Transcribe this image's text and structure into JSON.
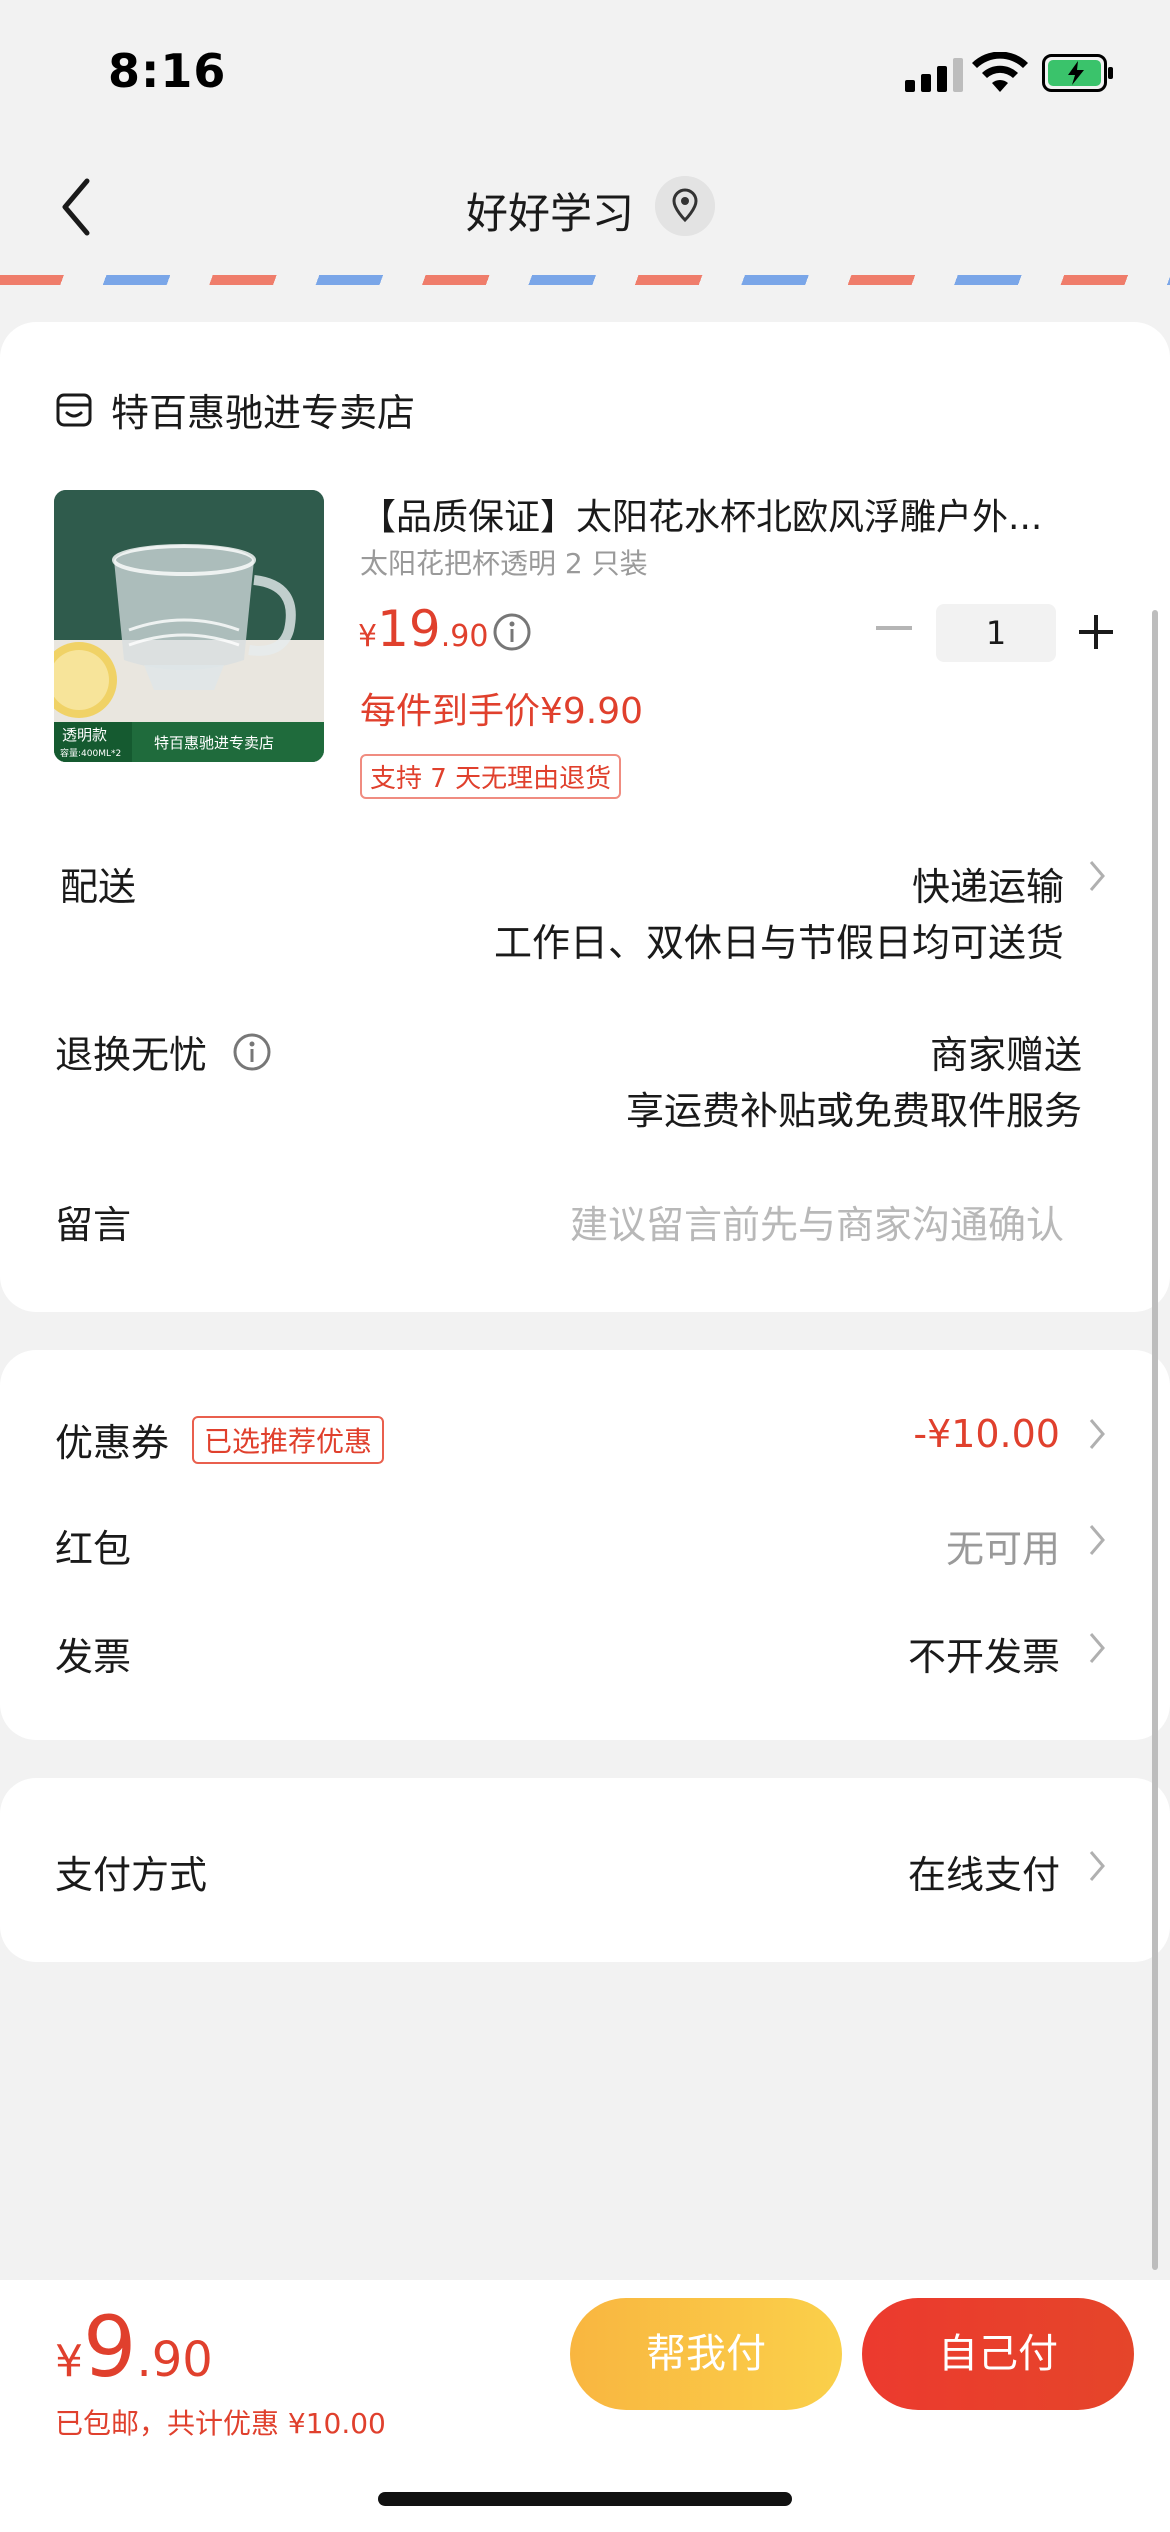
{
  "status_bar": {
    "time": "8:16"
  },
  "nav": {
    "title": "好好学习"
  },
  "shop": {
    "name": "特百惠驰进专卖店"
  },
  "product": {
    "title": "【品质保证】太阳花水杯北欧风浮雕户外...",
    "spec": "太阳花把杯透明 2 只装",
    "price_symbol": "¥",
    "price_int": "19",
    "price_dec": ".90",
    "final_price": "每件到手价¥9.90",
    "return_badge": "支持 7 天无理由退货",
    "quantity": "1",
    "image_texts": {
      "tag": "透明款",
      "capacity": "容量:400ML*2",
      "store": "特百惠驰进专卖店"
    }
  },
  "delivery": {
    "label": "配送",
    "value": "快递运输",
    "sub": "工作日、双休日与节假日均可送货"
  },
  "returns": {
    "label": "退换无忧",
    "value": "商家赠送",
    "sub": "享运费补贴或免费取件服务"
  },
  "message": {
    "label": "留言",
    "placeholder": "建议留言前先与商家沟通确认"
  },
  "coupon": {
    "label": "优惠券",
    "badge": "已选推荐优惠",
    "value": "-¥10.00"
  },
  "redpacket": {
    "label": "红包",
    "value": "无可用"
  },
  "invoice": {
    "label": "发票",
    "value": "不开发票"
  },
  "payment": {
    "label": "支付方式",
    "value": "在线支付"
  },
  "bottom": {
    "total_symbol": "¥",
    "total_int": "9",
    "total_dec": ".90",
    "note": "已包邮，共计优惠 ¥10.00",
    "help_pay": "帮我付",
    "self_pay": "自己付"
  },
  "colors": {
    "accent_red": "#e0402d",
    "help_button": "#f9b640",
    "self_button": "#ec3a2e"
  }
}
